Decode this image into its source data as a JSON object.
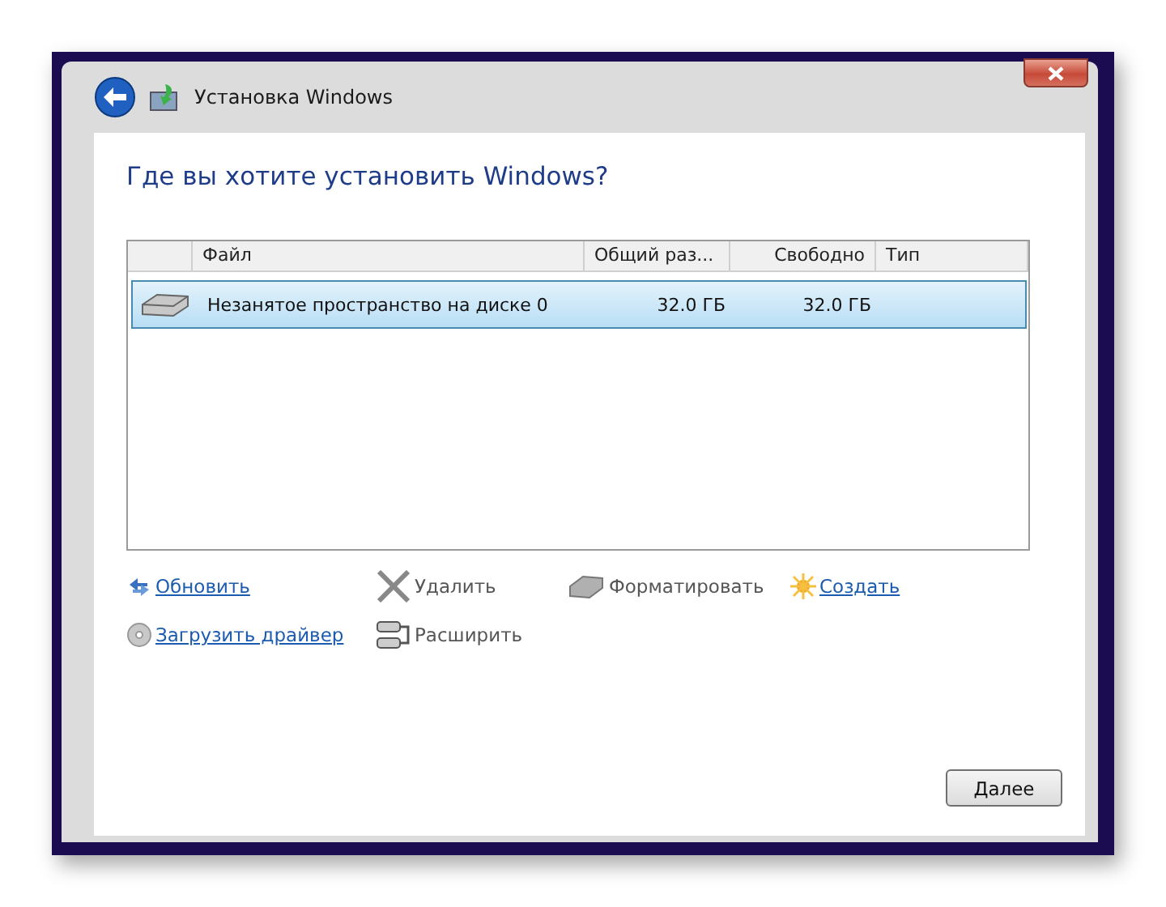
{
  "window": {
    "title": "Установка Windows"
  },
  "heading": "Где вы хотите установить Windows?",
  "table": {
    "columns": [
      "Файл",
      "Общий раз...",
      "Свободно",
      "Тип"
    ],
    "rows": [
      {
        "name": "Незанятое пространство на диске 0",
        "total": "32.0 ГБ",
        "free": "32.0 ГБ",
        "selected": true
      }
    ]
  },
  "actions": [
    {
      "kind": "refresh",
      "label": "Обновить",
      "disabled": false
    },
    {
      "kind": "delete",
      "label": "Удалить",
      "disabled": true
    },
    {
      "kind": "format",
      "label": "Форматировать",
      "disabled": true
    },
    {
      "kind": "new",
      "label": "Создать",
      "disabled": false
    },
    {
      "kind": "driver",
      "label": "Загрузить драйвер",
      "disabled": false
    },
    {
      "kind": "extend",
      "label": "Расширить",
      "disabled": true
    }
  ],
  "next_button": "Далее"
}
